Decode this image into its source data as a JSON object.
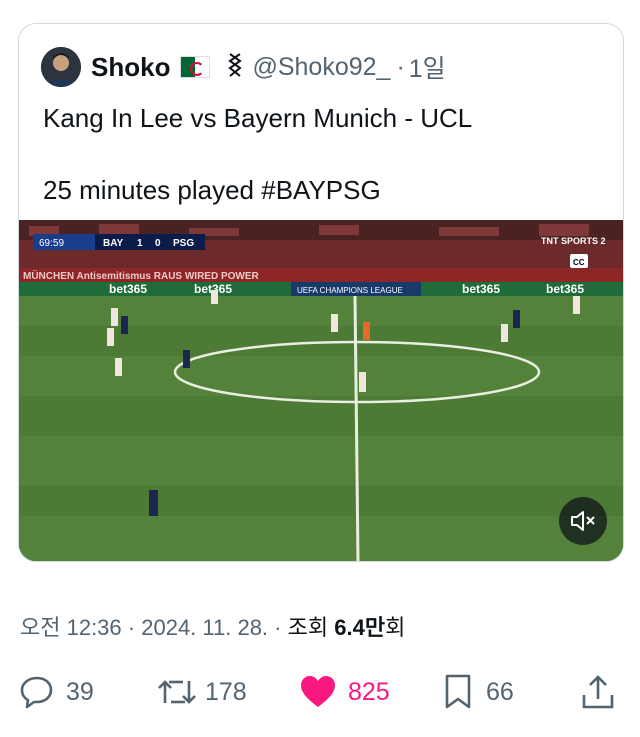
{
  "tweet": {
    "author_name": "Shoko",
    "handle": "@Shoko92_",
    "separator": "·",
    "time_ago": "1일",
    "text_line1": "Kang In Lee vs Bayern Munich - UCL",
    "text_line2": "25 minutes played #BAYPSG"
  },
  "video": {
    "clock": "69:59",
    "home_team": "BAY",
    "home_score": "1",
    "away_score": "0",
    "away_team": "PSG",
    "broadcaster": "TNT SPORTS 2",
    "cc_label": "CC",
    "ad_left": "bet365",
    "ad_right": "bet365",
    "ad_center": "UEFA CHAMPIONS LEAGUE",
    "stand_banner": "MÜNCHEN Antisemitismus RAUS  WIRED POWER"
  },
  "meta": {
    "time": "오전 12:36",
    "date": "2024. 11. 28.",
    "views_label_prefix": "조회",
    "views_count": "6.4만",
    "views_label_suffix": "회",
    "separator": "·"
  },
  "actions": {
    "replies": "39",
    "retweets": "178",
    "likes": "825",
    "bookmarks": "66"
  },
  "colors": {
    "like": "#f91880",
    "muted_text": "#536471",
    "pitch": "#4d7a35"
  }
}
